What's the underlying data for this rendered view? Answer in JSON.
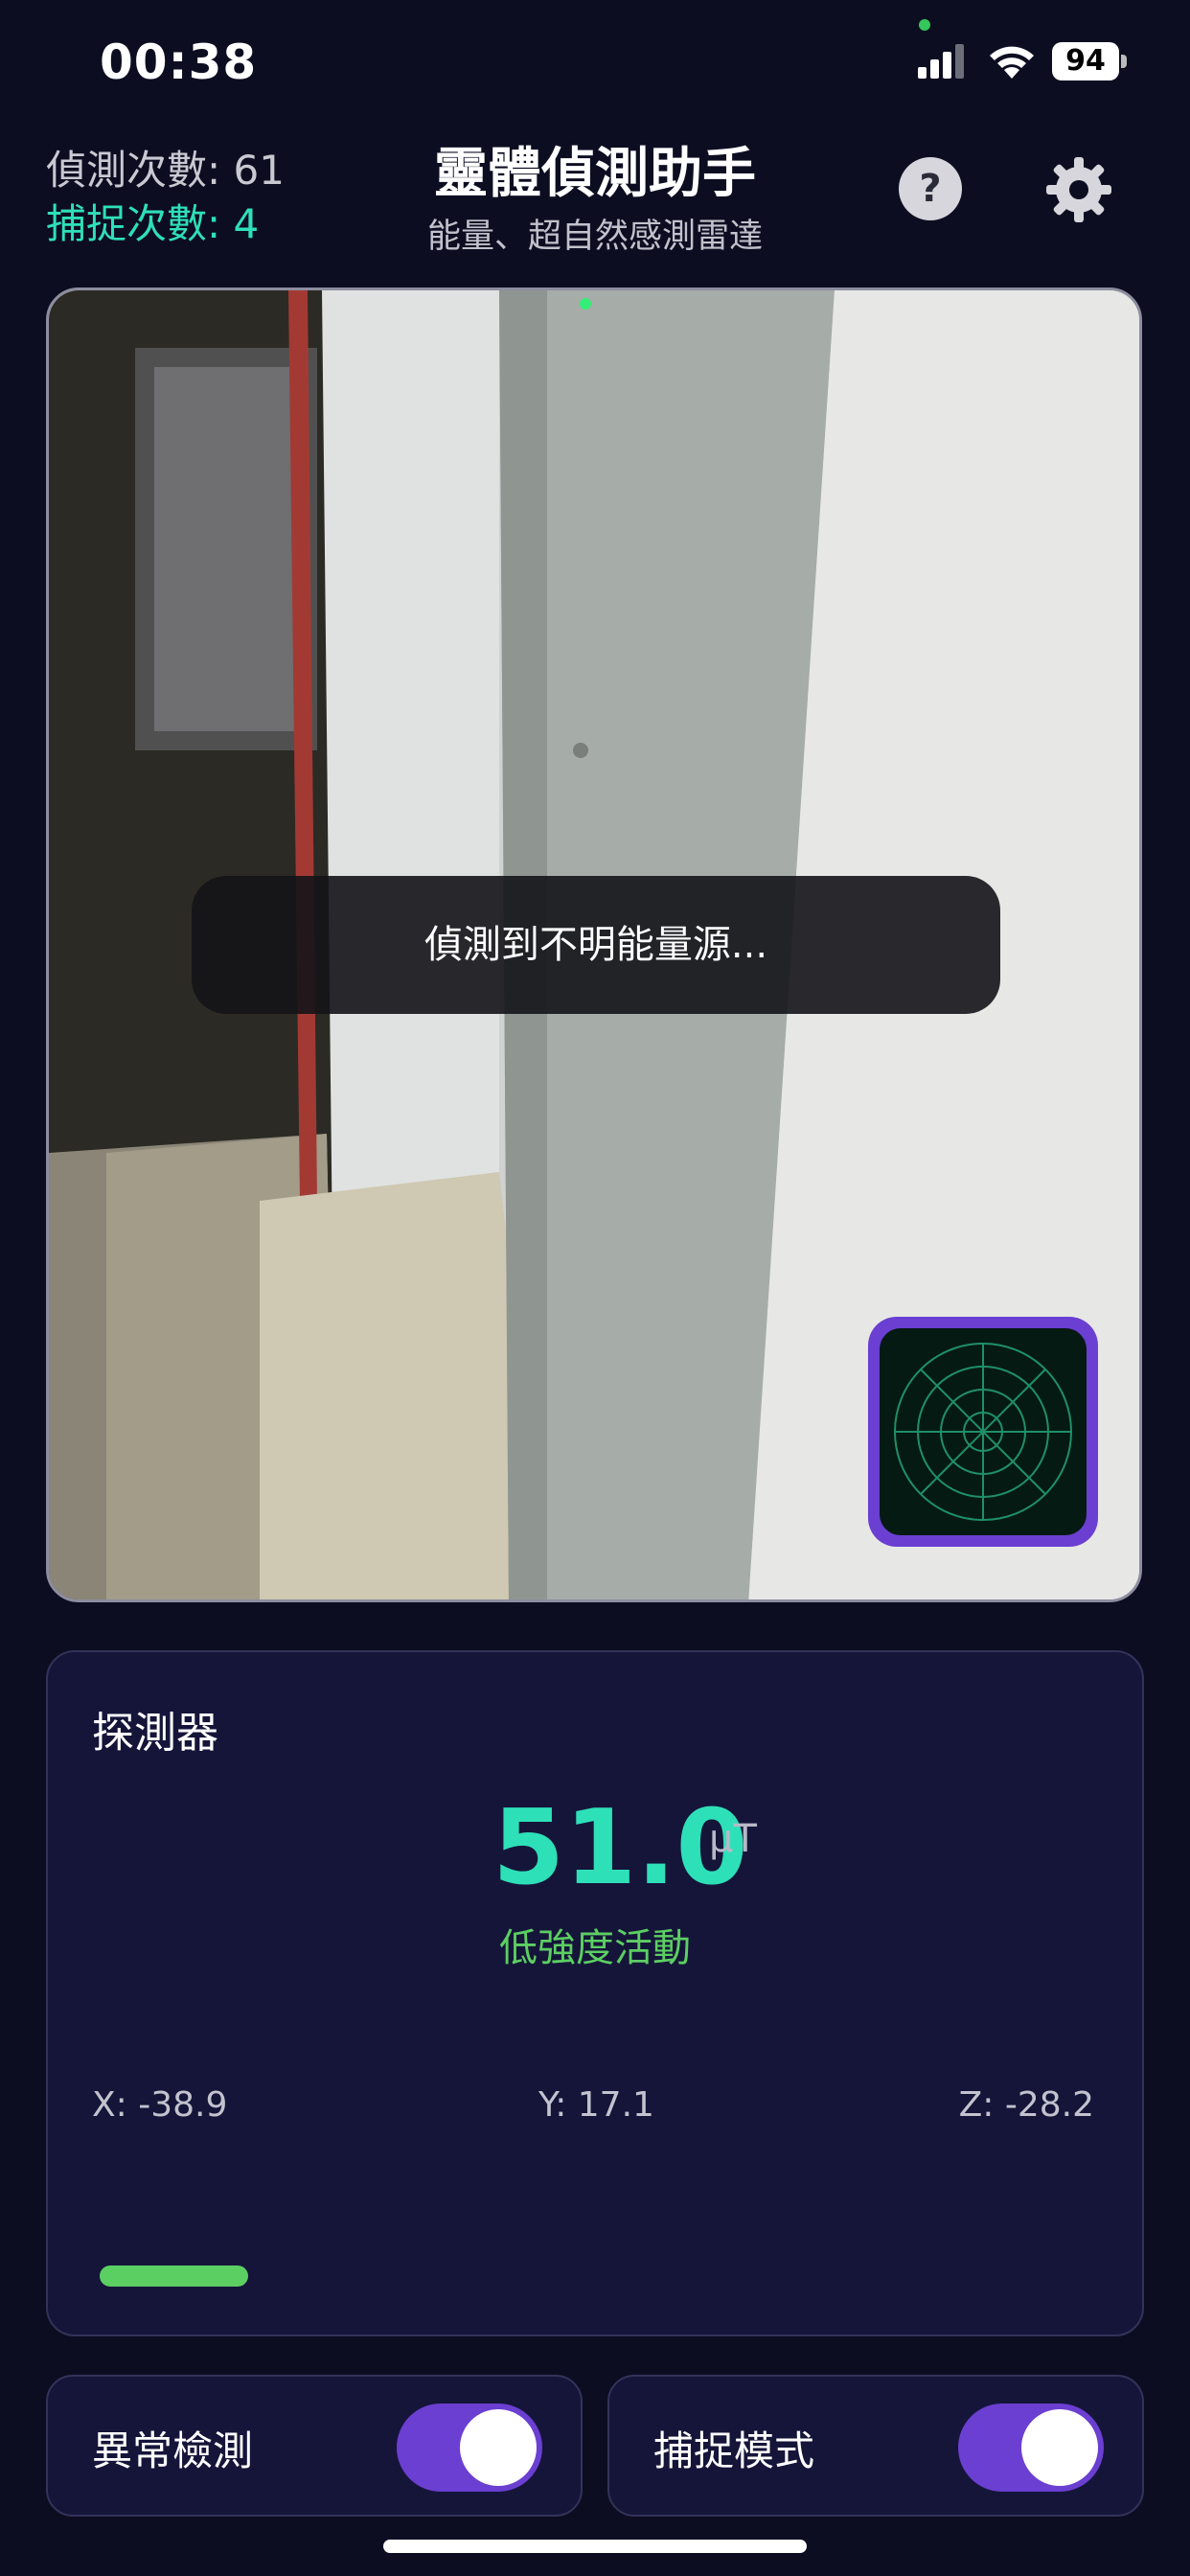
{
  "status_bar": {
    "time": "00:38",
    "battery": "94",
    "icons": [
      "privacy-dot-icon",
      "cellular-signal-icon",
      "wifi-icon",
      "battery-icon"
    ]
  },
  "header": {
    "detect_count_label": "偵測次數: 61",
    "capture_count_label": "捕捉次數: 4",
    "title": "靈體偵測助手",
    "subtitle": "能量、超自然感測雷達",
    "icons": [
      "help-icon",
      "gear-icon"
    ]
  },
  "camera": {
    "toast": "偵測到不明能量源...",
    "radar_icon": "radar-icon"
  },
  "detector": {
    "title": "探測器",
    "value": "51.0",
    "unit": "µT",
    "status": "低強度活動",
    "x": "X: -38.9",
    "y": "Y: 17.1",
    "z": "Z: -28.2",
    "level": 0.15,
    "level_color": "#5ccf62"
  },
  "toggles": [
    {
      "label": "異常檢測",
      "on": true
    },
    {
      "label": "捕捉模式",
      "on": true
    }
  ],
  "colors": {
    "background": "#0d0d22",
    "accent_cyan": "#2ee0b8",
    "accent_purple": "#6a3fd1",
    "panel": "#15153a"
  }
}
